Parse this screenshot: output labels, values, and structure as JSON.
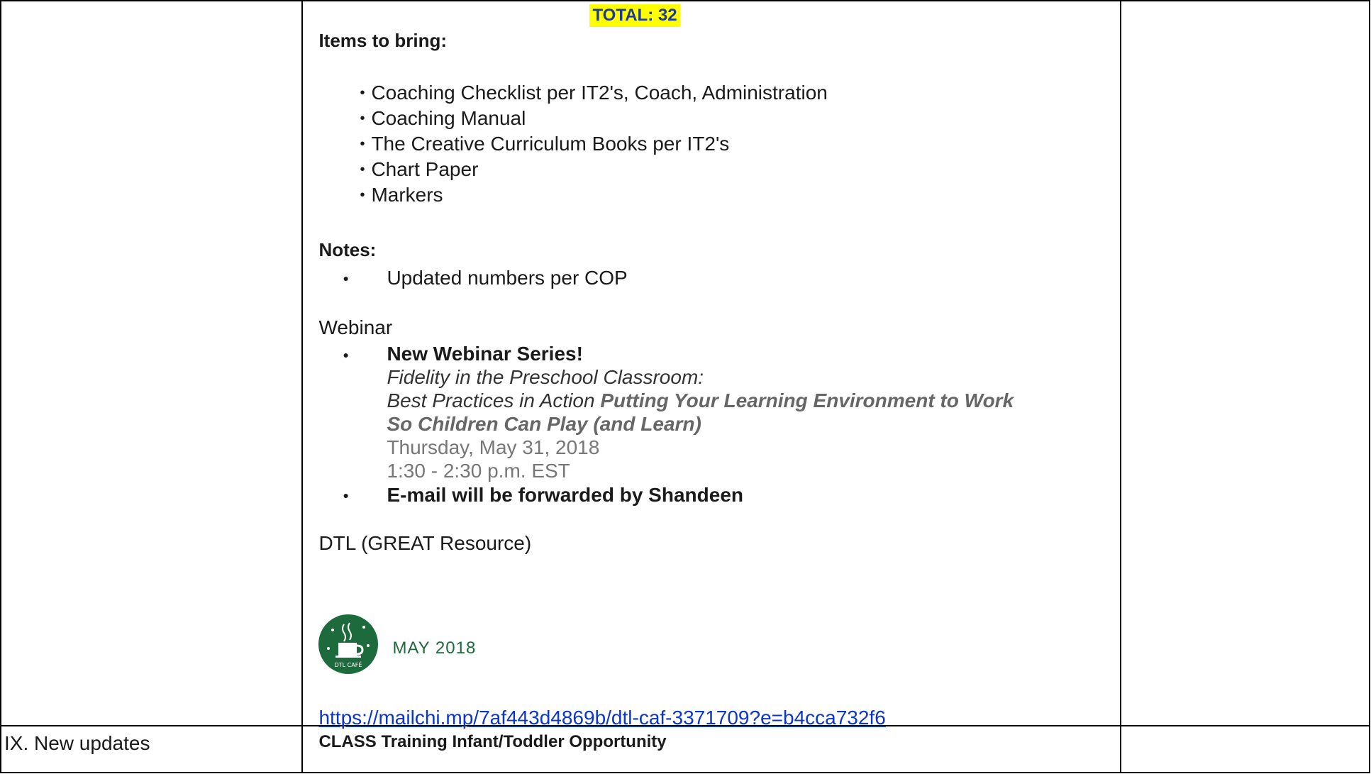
{
  "total": "TOTAL: 32",
  "items_label": "Items to bring:",
  "items": [
    "Coaching Checklist per IT2's, Coach, Administration",
    "Coaching Manual",
    "The Creative Curriculum Books per IT2's",
    "Chart Paper",
    "Markers"
  ],
  "notes_label": "Notes:",
  "notes": [
    "Updated numbers per COP"
  ],
  "webinar": {
    "title": "Webinar",
    "series": "New Webinar Series!",
    "line1": "Fidelity in the Preschool Classroom:",
    "line2_a": "Best Practices in Action ",
    "line2_b": "Putting Your Learning Environment to Work",
    "line3": "So Children Can Play (and Learn)",
    "date": "Thursday, May 31, 2018",
    "time": "1:30 - 2:30 p.m. EST",
    "email": "E-mail will be forwarded by Shandeen"
  },
  "dtl": {
    "title": "DTL (GREAT Resource)",
    "logo_text": "DTL CAFÉ",
    "logo_caption": "MAY 2018",
    "link": "https://mailchi.mp/7af443d4869b/dtl-caf-3371709?e=b4cca732f6"
  },
  "row_ix": {
    "label": "IX. New updates",
    "content": "CLASS Training Infant/Toddler Opportunity"
  },
  "colors": {
    "highlight": "#ffff00",
    "total_text": "#1f3a93",
    "logo_green": "#1d6b3d",
    "link": "#0b35cc"
  }
}
